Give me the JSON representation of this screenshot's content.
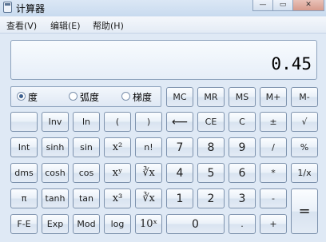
{
  "window": {
    "title": "计算器",
    "minimize_label": "—",
    "maximize_label": "▭",
    "close_label": "✕"
  },
  "menu": [
    "查看(V)",
    "编辑(E)",
    "帮助(H)"
  ],
  "display": {
    "value": "0.45"
  },
  "angle_modes": [
    {
      "label": "度",
      "selected": true
    },
    {
      "label": "弧度",
      "selected": false
    },
    {
      "label": "梯度",
      "selected": false
    }
  ],
  "memory_buttons": [
    "MC",
    "MR",
    "MS",
    "M+",
    "M-"
  ],
  "sci_buttons": [
    [
      "",
      "Inv",
      "ln",
      "(",
      ")"
    ],
    [
      "Int",
      "sinh",
      "sin",
      "x²",
      "n!"
    ],
    [
      "dms",
      "cosh",
      "cos",
      "xʸ",
      "∛x"
    ],
    [
      "π",
      "tanh",
      "tan",
      "x³",
      "∛x"
    ],
    [
      "F-E",
      "Exp",
      "Mod",
      "log",
      "10ˣ"
    ]
  ],
  "std_buttons": [
    [
      "⟵",
      "CE",
      "C",
      "±",
      "√"
    ],
    [
      "7",
      "8",
      "9",
      "/",
      "%"
    ],
    [
      "4",
      "5",
      "6",
      "*",
      "1/x"
    ],
    [
      "1",
      "2",
      "3",
      "-",
      "="
    ],
    [
      "0",
      ".",
      "+"
    ]
  ]
}
